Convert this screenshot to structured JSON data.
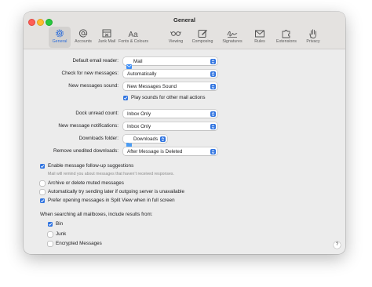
{
  "window": {
    "title": "General"
  },
  "tabs": [
    {
      "label": "General",
      "icon": "gear-icon"
    },
    {
      "label": "Accounts",
      "icon": "at-icon"
    },
    {
      "label": "Junk Mail",
      "icon": "junk-tray-icon"
    },
    {
      "label": "Fonts & Colours",
      "icon": "font-aa-icon"
    },
    {
      "label": "Viewing",
      "icon": "glasses-icon"
    },
    {
      "label": "Composing",
      "icon": "compose-icon"
    },
    {
      "label": "Signatures",
      "icon": "signature-icon"
    },
    {
      "label": "Rules",
      "icon": "envelope-rules-icon"
    },
    {
      "label": "Extensions",
      "icon": "puzzle-icon"
    },
    {
      "label": "Privacy",
      "icon": "hand-icon"
    }
  ],
  "settings": {
    "default_email_reader": {
      "label": "Default email reader:",
      "value": "Mail"
    },
    "check_new_messages": {
      "label": "Check for new messages:",
      "value": "Automatically"
    },
    "new_messages_sound": {
      "label": "New messages sound:",
      "value": "New Messages Sound"
    },
    "play_sounds": {
      "label": "Play sounds for other mail actions",
      "checked": true
    },
    "dock_unread_count": {
      "label": "Dock unread count:",
      "value": "Inbox Only"
    },
    "new_message_notifications": {
      "label": "New message notifications:",
      "value": "Inbox Only"
    },
    "downloads_folder": {
      "label": "Downloads folder:",
      "value": "Downloads"
    },
    "remove_unedited_downloads": {
      "label": "Remove unedited downloads:",
      "value": "After Message is Deleted"
    }
  },
  "options": {
    "follow_up": {
      "label": "Enable message follow-up suggestions",
      "checked": true,
      "sublabel": "Mail will remind you about messages that haven’t received responses."
    },
    "archive_muted": {
      "label": "Archive or delete muted messages",
      "checked": false
    },
    "retry_sending": {
      "label": "Automatically try sending later if outgoing server is unavailable",
      "checked": false
    },
    "split_view": {
      "label": "Prefer opening messages in Split View when in full screen",
      "checked": true
    }
  },
  "search": {
    "heading": "When searching all mailboxes, include results from:",
    "items": [
      {
        "label": "Bin",
        "checked": true
      },
      {
        "label": "Junk",
        "checked": false
      },
      {
        "label": "Encrypted Messages",
        "checked": false
      }
    ]
  },
  "help": {
    "label": "?"
  }
}
